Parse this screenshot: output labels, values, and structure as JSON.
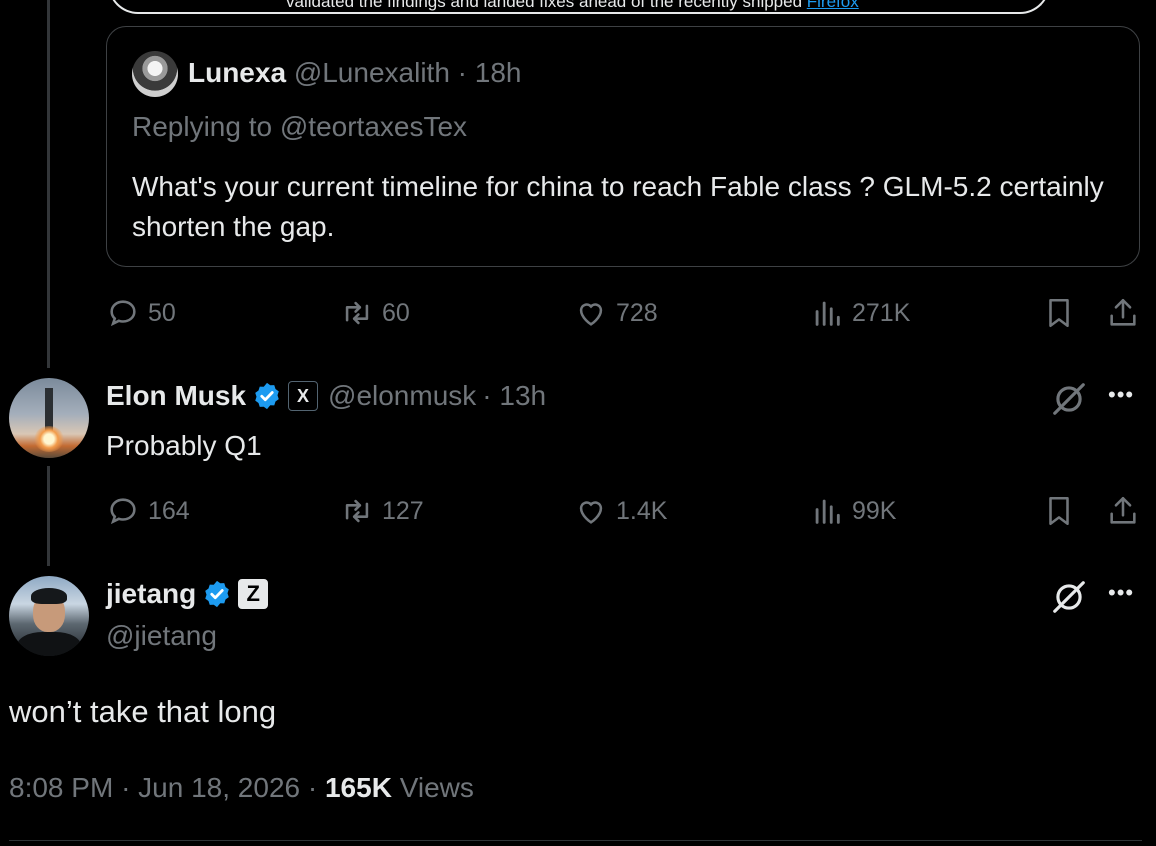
{
  "top_card": {
    "text": "validated the findings and landed fixes ahead of the recently shipped ",
    "link": "Firefox"
  },
  "quoted": {
    "name": "Lunexa",
    "handle": "@Lunexalith",
    "time": "· 18h",
    "replying_prefix": "Replying to ",
    "replying_to": "@teortaxesTex",
    "text": "What's your current timeline for china to reach Fable class ? GLM-5.2 certainly shorten the gap."
  },
  "quoted_actions": {
    "replies": "50",
    "reposts": "60",
    "likes": "728",
    "views": "271K"
  },
  "reply": {
    "name": "Elon Musk",
    "affiliation_badge": "X",
    "handle": "@elonmusk",
    "time": "· 13h",
    "text": "Probably Q1"
  },
  "reply_actions": {
    "replies": "164",
    "reposts": "127",
    "likes": "1.4K",
    "views": "99K"
  },
  "main": {
    "name": "jietang",
    "affiliation_badge": "Z",
    "handle": "@jietang",
    "text": "won’t take that long",
    "time": "8:08 PM",
    "date": "Jun 18, 2026",
    "separator": "·",
    "views_count": "165K",
    "views_label": "Views"
  },
  "colors": {
    "background": "#000000",
    "text": "#e7e9ea",
    "muted": "#71767b",
    "verified": "#1d9bf0",
    "border": "#3e4144"
  },
  "icons": [
    "reply-icon",
    "repost-icon",
    "like-icon",
    "views-icon",
    "bookmark-icon",
    "share-icon",
    "grok-icon",
    "more-icon",
    "verified-icon"
  ]
}
